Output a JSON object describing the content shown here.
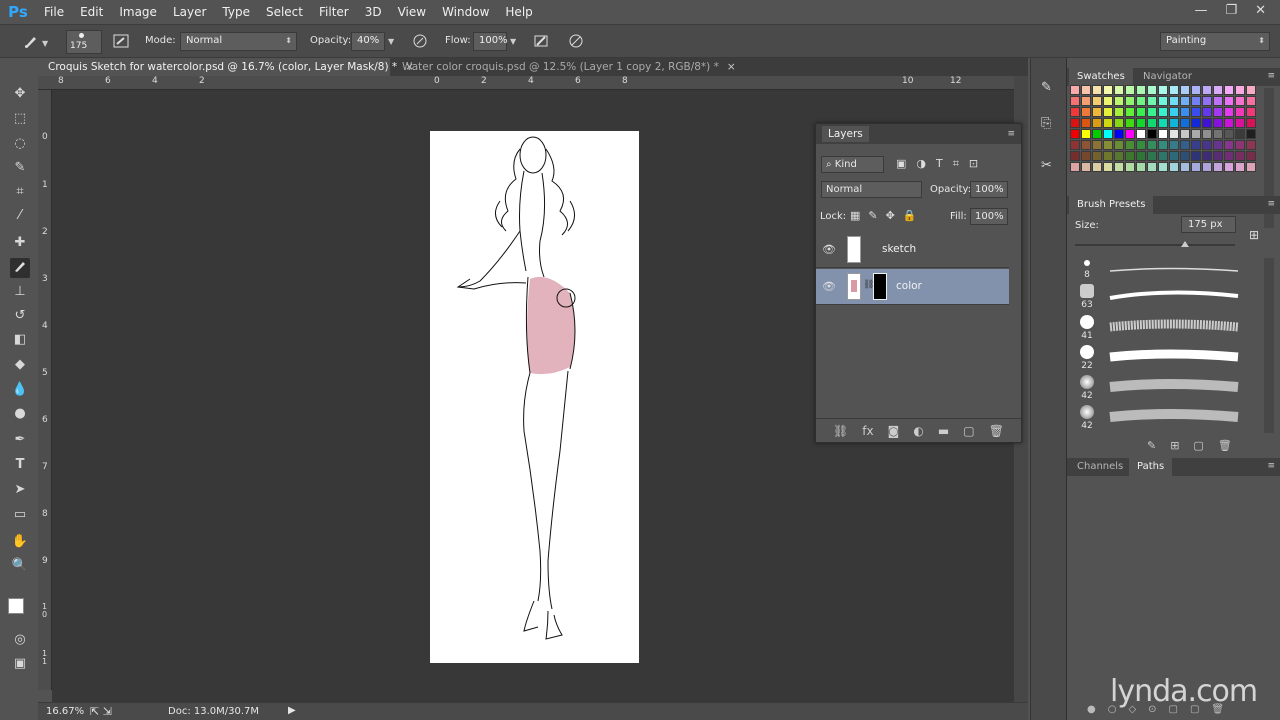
{
  "app": {
    "logo": "Ps"
  },
  "menu": [
    "File",
    "Edit",
    "Image",
    "Layer",
    "Type",
    "Select",
    "Filter",
    "3D",
    "View",
    "Window",
    "Help"
  ],
  "window_controls": {
    "minimize": "—",
    "restore": "❐",
    "close": "✕"
  },
  "options": {
    "brush_size": "175",
    "mode_label": "Mode:",
    "mode_value": "Normal",
    "opacity_label": "Opacity:",
    "opacity_value": "40%",
    "flow_label": "Flow:",
    "flow_value": "100%",
    "workspace": "Painting"
  },
  "tabs": [
    {
      "label": "Croquis Sketch for watercolor.psd @ 16.7% (color, Layer Mask/8) *",
      "active": true
    },
    {
      "label": "Water color croquis.psd @ 12.5% (Layer 1 copy 2, RGB/8*) *",
      "active": false
    }
  ],
  "ruler": {
    "h": [
      "8",
      "6",
      "4",
      "2",
      "0",
      "2",
      "4",
      "6",
      "8",
      "10",
      "12"
    ],
    "v": [
      "0",
      "1",
      "2",
      "3",
      "4",
      "5",
      "6",
      "7",
      "8",
      "9",
      "1 0",
      "1 1"
    ]
  },
  "status": {
    "zoom": "16.67%",
    "doc": "Doc: 13.0M/30.7M"
  },
  "layers_panel": {
    "title": "Layers",
    "filter_label": "Kind",
    "blend_mode": "Normal",
    "opacity_label": "Opacity:",
    "opacity_value": "100%",
    "lock_label": "Lock:",
    "fill_label": "Fill:",
    "fill_value": "100%",
    "layers": [
      {
        "name": "sketch",
        "selected": false
      },
      {
        "name": "color",
        "selected": true
      }
    ]
  },
  "swatches_panel": {
    "tabs": [
      "Swatches",
      "Navigator"
    ]
  },
  "brush_presets": {
    "title": "Brush Presets",
    "size_label": "Size:",
    "size_value": "175 px",
    "sizes": [
      "8",
      "63",
      "41",
      "22",
      "42",
      "42"
    ]
  },
  "bottom_panel": {
    "tabs": [
      "Channels",
      "Paths"
    ]
  },
  "watermark": "lynda.com",
  "colors": {
    "selected_layer": "#8292ad",
    "canvas_bg": "#383838",
    "ps_blue": "#31a8ff",
    "watercolor": "#d89aa5"
  }
}
